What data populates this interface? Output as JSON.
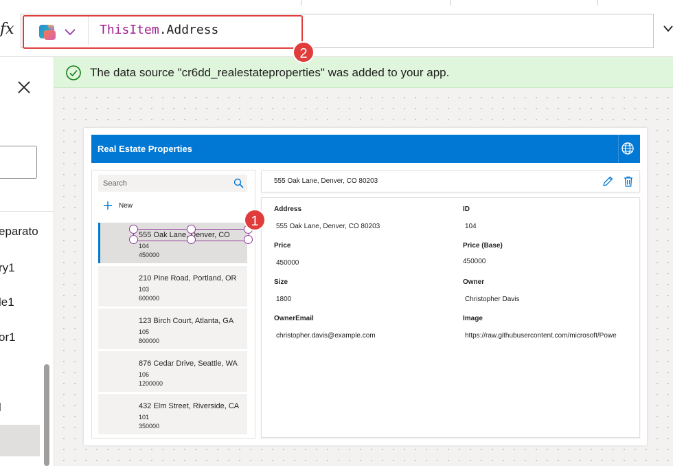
{
  "formula_bar": {
    "fx": "fx",
    "formula_keyword": "ThisItem",
    "formula_rest": ".Address"
  },
  "left_panel": {
    "tree_items": [
      "eparato",
      "ry1",
      "le1",
      "or1",
      "l"
    ]
  },
  "notification": {
    "message": "The data source \"cr6dd_realestateproperties\" was added to your app."
  },
  "app": {
    "title": "Real Estate Properties",
    "gallery": {
      "search_placeholder": "Search",
      "new_label": "New",
      "items": [
        {
          "title": "555 Oak Lane, Denver, CO",
          "id": "104",
          "price": "450000"
        },
        {
          "title": "210 Pine Road, Portland, OR",
          "id": "103",
          "price": "600000"
        },
        {
          "title": "123 Birch Court, Atlanta, GA",
          "id": "105",
          "price": "800000"
        },
        {
          "title": "876 Cedar Drive, Seattle, WA",
          "id": "106",
          "price": "1200000"
        },
        {
          "title": "432 Elm Street, Riverside, CA",
          "id": "101",
          "price": "350000"
        }
      ]
    },
    "detail": {
      "title": "555 Oak Lane, Denver, CO 80203",
      "fields": {
        "address_label": "Address",
        "address_value": "555 Oak Lane, Denver, CO 80203",
        "id_label": "ID",
        "id_value": "104",
        "price_label": "Price",
        "price_value": "450000",
        "price_base_label": "Price (Base)",
        "price_base_value": "450000",
        "size_label": "Size",
        "size_value": "1800",
        "owner_label": "Owner",
        "owner_value": "Christopher Davis",
        "owner_email_label": "OwnerEmail",
        "owner_email_value": "christopher.davis@example.com",
        "image_label": "Image",
        "image_value": "https://raw.githubusercontent.com/microsoft/Powe"
      }
    }
  },
  "badges": {
    "step1": "1",
    "step2": "2"
  },
  "colors": {
    "accent": "#0078d4",
    "badge": "#e03c3c",
    "selection": "#8e3b9c",
    "notify_bg": "#dff6dd"
  }
}
